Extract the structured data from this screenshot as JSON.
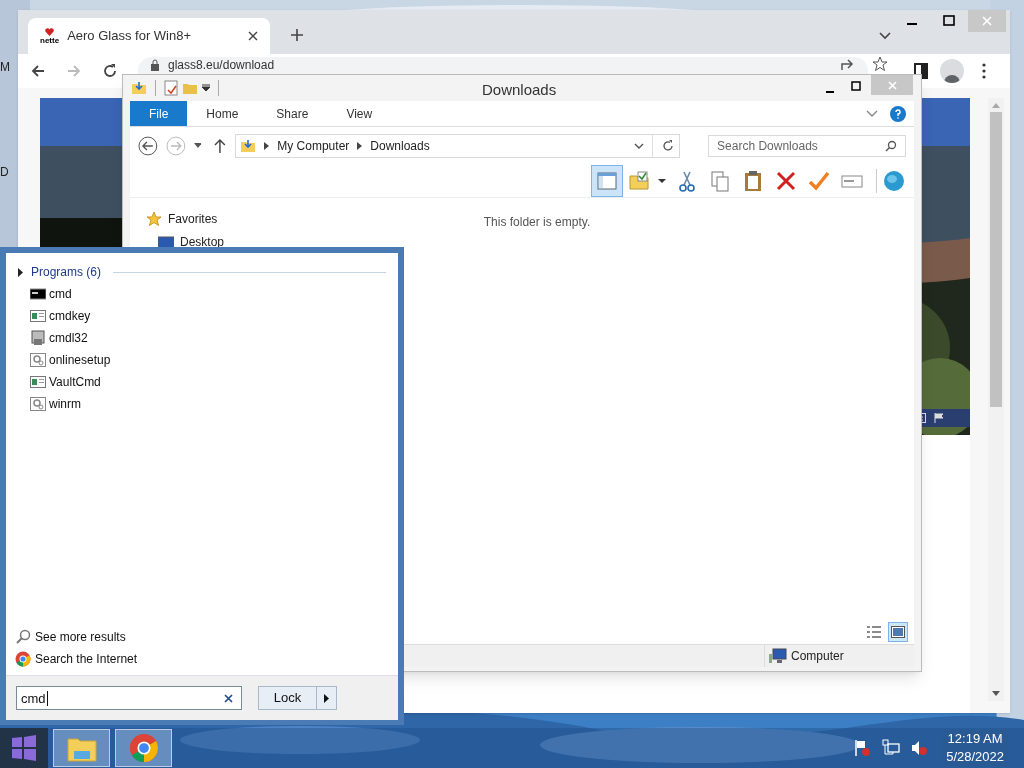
{
  "desktop_labels": [
    "M",
    "D"
  ],
  "browser": {
    "tab": {
      "title": "Aero Glass for Win8+",
      "favicon_label": "nette"
    },
    "url": "glass8.eu/download"
  },
  "explorer": {
    "title": "Downloads",
    "ribbon_tabs": [
      {
        "label": "File",
        "selected": true
      },
      {
        "label": "Home",
        "selected": false
      },
      {
        "label": "Share",
        "selected": false
      },
      {
        "label": "View",
        "selected": false
      }
    ],
    "breadcrumb": [
      "My Computer",
      "Downloads"
    ],
    "search_placeholder": "Search Downloads",
    "toolbar": [
      {
        "kind": "pane",
        "on": true
      },
      {
        "kind": "folder-check",
        "on": false
      },
      {
        "kind": "cut",
        "on": false
      },
      {
        "kind": "copy",
        "on": false
      },
      {
        "kind": "paste",
        "on": false
      },
      {
        "kind": "delete",
        "on": false
      },
      {
        "kind": "check",
        "on": false
      },
      {
        "kind": "rename",
        "on": false
      },
      {
        "kind": "globe",
        "on": false
      }
    ],
    "nav": [
      {
        "label": "Favorites",
        "kind": "group"
      },
      {
        "label": "Desktop",
        "kind": "item"
      }
    ],
    "empty_message": "This folder is empty.",
    "views": [
      {
        "kind": "details",
        "selected": false
      },
      {
        "kind": "preview",
        "selected": true
      }
    ],
    "status": "Computer"
  },
  "start_menu": {
    "group_label": "Programs (6)",
    "programs": [
      {
        "label": "cmd",
        "kind": "console"
      },
      {
        "label": "cmdkey",
        "kind": "app"
      },
      {
        "label": "cmdl32",
        "kind": "installer"
      },
      {
        "label": "onlinesetup",
        "kind": "setup"
      },
      {
        "label": "VaultCmd",
        "kind": "app"
      },
      {
        "label": "winrm",
        "kind": "setup"
      }
    ],
    "links": [
      {
        "label": "See more results",
        "kind": "search"
      },
      {
        "label": "Search the Internet",
        "kind": "chrome"
      }
    ],
    "search_value": "cmd",
    "power_button": "Lock"
  },
  "taskbar": {
    "apps": [
      {
        "kind": "explorer"
      },
      {
        "kind": "chrome"
      }
    ],
    "time": "12:19 AM",
    "date": "5/28/2022"
  }
}
